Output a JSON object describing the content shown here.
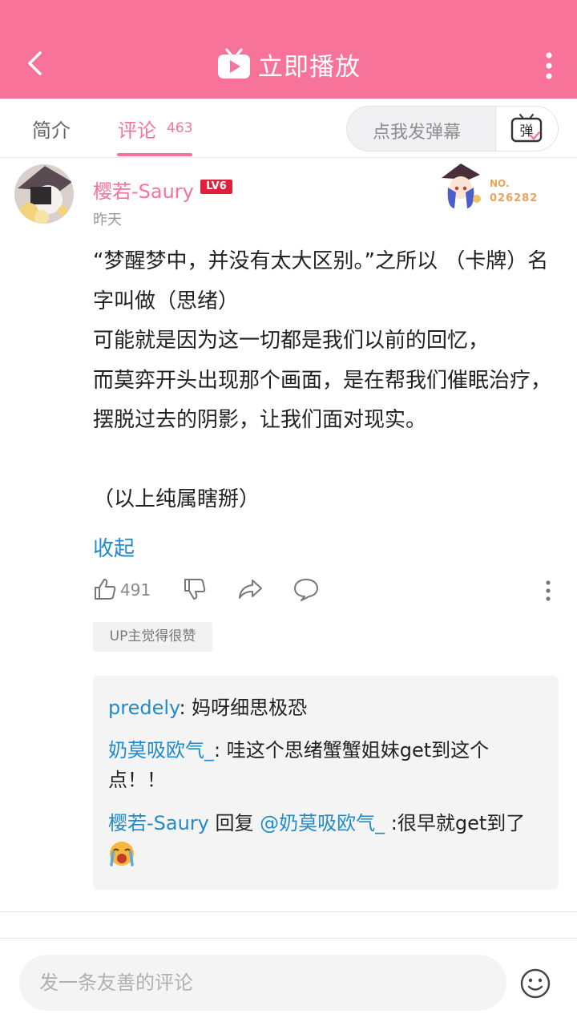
{
  "header": {
    "title": "立即播放",
    "bg_color": "#f87399",
    "back_icon": "chevron-left-icon",
    "tv_icon": "bilibili-tv-icon",
    "more_icon": "more-vertical-icon"
  },
  "tabs": {
    "intro_label": "简介",
    "comment_label": "评论",
    "comment_count": "463",
    "danmaku_placeholder": "点我发弹幕",
    "danmaku_icon_text": "弹"
  },
  "comment": {
    "username": "樱若-Saury",
    "level": "LV6",
    "time": "昨天",
    "fan_badge": {
      "label": "NO.",
      "number": "026282"
    },
    "paragraphs": [
      "“梦醒梦中，并没有太大区别。”之所以 （卡牌）名字叫做（思绪）",
      "可能就是因为这一切都是我们以前的回忆，",
      "而莫弈开头出现那个画面，是在帮我们催眠治疗，摆脱过去的阴影，让我们面对现实。",
      "",
      "（以上纯属瞎掰）"
    ],
    "collapse_label": "收起",
    "like_count": "491",
    "up_badge": "UP主觉得很赞"
  },
  "replies": [
    {
      "name": "predely",
      "text": ": 妈呀细思极恐"
    },
    {
      "name": "奶莫吸欧气_",
      "text": ": 哇这个思绪蟹蟹姐妹get到这个点！！"
    },
    {
      "name": "樱若-Saury",
      "verb": " 回复 ",
      "mention": "@奶莫吸欧气_",
      "text": " :很早就get到了"
    }
  ],
  "bottom": {
    "input_placeholder": "发一条友善的评论",
    "emoji_icon": "smile-icon"
  },
  "colors": {
    "accent": "#f87399",
    "link": "#1f8bc9",
    "level_badge": "#e0203a"
  }
}
